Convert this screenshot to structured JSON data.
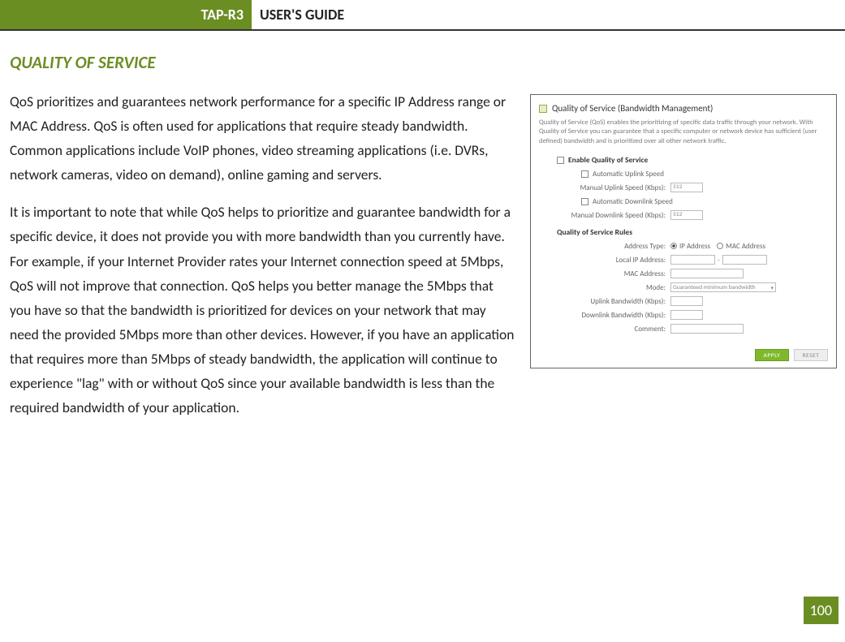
{
  "header": {
    "product": "TAP-R3",
    "title": "USER'S GUIDE"
  },
  "section_heading": "QUALITY OF SERVICE",
  "paragraphs": {
    "p1": "QoS prioritizes and guarantees network performance for a specific IP Address range or MAC Address. QoS is often used for applications that require steady bandwidth. Common applications include VoIP phones, video streaming applications (i.e. DVRs, network cameras, video on demand), online gaming and servers.",
    "p2": "It is important to note that while QoS helps to prioritize and guarantee bandwidth for a specific device, it does not provide you with more bandwidth than you currently have. For example, if your Internet Provider rates your Internet connection speed at 5Mbps, QoS will not improve that connection. QoS helps you better manage the 5Mbps that you have so that the bandwidth is prioritized for devices on your network that may need the provided 5Mbps more than other devices. However, if you have an application that requires more than 5Mbps of steady bandwidth, the application will continue to experience \"lag\" with or without QoS since your available bandwidth is less than the required bandwidth of your application."
  },
  "figure": {
    "title": "Quality of Service (Bandwidth Management)",
    "desc": "Quality of Service (QoS) enables the prioritizing of specific data traffic through your network. With Quality of Service you can guarantee that a specific computer or network device has sufficient (user defined) bandwidth and is prioritized over all other network traffic.",
    "enable_label": "Enable Quality of Service",
    "auto_uplink": "Automatic Uplink Speed",
    "manual_uplink": "Manual Uplink Speed (Kbps):",
    "auto_downlink": "Automatic Downlink Speed",
    "manual_downlink": "Manual Downlink Speed (Kbps):",
    "speed_value": "512",
    "rules_heading": "Quality of Service Rules",
    "address_type": "Address Type:",
    "ip_radio": "IP Address",
    "mac_radio": "MAC Address",
    "local_ip": "Local IP Address:",
    "mac_addr": "MAC Address:",
    "mode": "Mode:",
    "mode_value": "Guaranteed minimum bandwidth",
    "uplink_bw": "Uplink Bandwidth (Kbps):",
    "downlink_bw": "Downlink Bandwidth (Kbps):",
    "comment": "Comment:",
    "apply": "APPLY",
    "reset": "RESET"
  },
  "page_number": "100"
}
